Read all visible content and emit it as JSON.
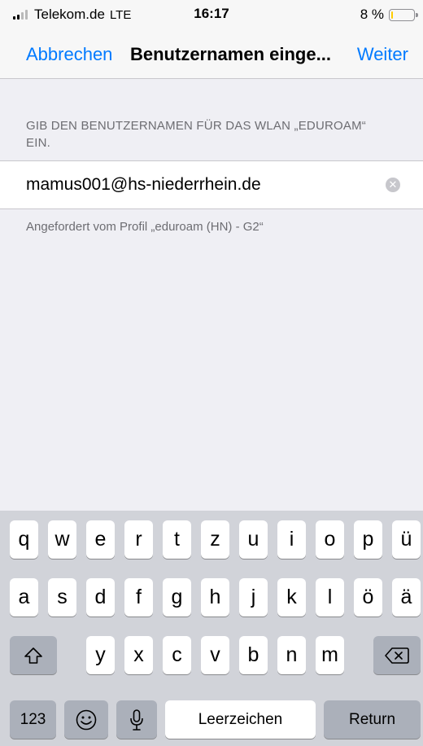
{
  "status_bar": {
    "carrier": "Telekom.de",
    "network": "LTE",
    "time": "16:17",
    "battery_percent": "8 %",
    "battery_level": 0.08,
    "battery_color": "#ffcc00"
  },
  "nav": {
    "cancel_label": "Abbrechen",
    "title": "Benutzernamen einge...",
    "next_label": "Weiter"
  },
  "form": {
    "section_header": "GIB DEN BENUTZERNAMEN FÜR DAS WLAN „EDUROAM“ EIN.",
    "username_value": "mamus001@hs-niederrhein.de",
    "footer_note": "Angefordert vom Profil „eduroam (HN) - G2“"
  },
  "keyboard": {
    "row1": [
      "q",
      "w",
      "e",
      "r",
      "t",
      "z",
      "u",
      "i",
      "o",
      "p",
      "ü"
    ],
    "row2": [
      "a",
      "s",
      "d",
      "f",
      "g",
      "h",
      "j",
      "k",
      "l",
      "ö",
      "ä"
    ],
    "row3": [
      "y",
      "x",
      "c",
      "v",
      "b",
      "n",
      "m"
    ],
    "numbers_label": "123",
    "space_label": "Leerzeichen",
    "return_label": "Return"
  },
  "colors": {
    "accent": "#007aff",
    "background": "#efeff4",
    "keyboard_bg": "#d1d3d9"
  }
}
